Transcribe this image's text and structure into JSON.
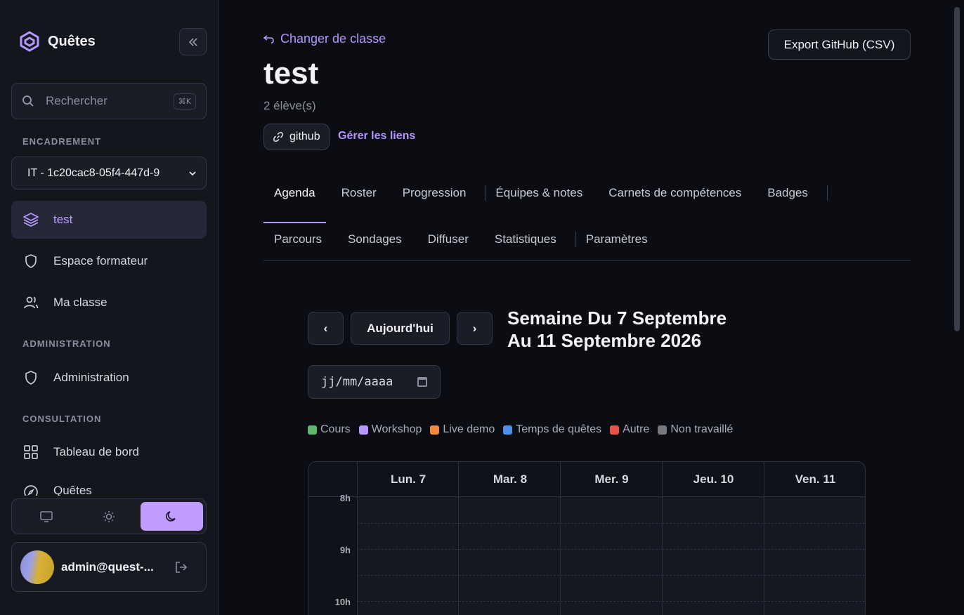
{
  "sidebar": {
    "brand": "Quêtes",
    "search_label": "Rechercher",
    "search_shortcut": "⌘K",
    "section_encadrement": "ENCADREMENT",
    "class_select": "IT - 1c20cac8-05f4-447d-9",
    "nav_encadrement": [
      {
        "label": "test",
        "icon": "layers-icon"
      },
      {
        "label": "Espace formateur",
        "icon": "shield-icon"
      },
      {
        "label": "Ma classe",
        "icon": "users-icon"
      }
    ],
    "section_administration": "ADMINISTRATION",
    "nav_administration": [
      {
        "label": "Administration",
        "icon": "shield-icon"
      }
    ],
    "section_consultation": "CONSULTATION",
    "nav_consultation": [
      {
        "label": "Tableau de bord",
        "icon": "grid-icon"
      },
      {
        "label": "Quêtes",
        "icon": "compass-icon"
      }
    ],
    "theme_options": [
      "system",
      "light",
      "dark"
    ],
    "theme_selected": "dark",
    "user_email": "admin@quest-..."
  },
  "header": {
    "back_link": "Changer de classe",
    "title": "test",
    "student_count": "2 élève(s)",
    "link_chip": "github",
    "manage_links": "Gérer les liens",
    "export_button": "Export GitHub (CSV)"
  },
  "tabs_row1": [
    "Agenda",
    "Roster",
    "Progression",
    "Équipes & notes",
    "Carnets de compétences",
    "Badges"
  ],
  "tabs_row2": [
    "Parcours",
    "Sondages",
    "Diffuser",
    "Statistiques",
    "Paramètres"
  ],
  "active_tab": "Agenda",
  "agenda": {
    "prev": "‹",
    "today": "Aujourd'hui",
    "next": "›",
    "week_line1": "Semaine Du 7 Septembre",
    "week_line2": "Au 11 Septembre 2026",
    "date_placeholder": "jj/mm/aaaa",
    "legend": [
      {
        "label": "Cours",
        "color": "#5fb56a"
      },
      {
        "label": "Workshop",
        "color": "#b597ff"
      },
      {
        "label": "Live demo",
        "color": "#f08a3c"
      },
      {
        "label": "Temps de quêtes",
        "color": "#4f8fe8"
      },
      {
        "label": "Autre",
        "color": "#e5534b"
      },
      {
        "label": "Non travaillé",
        "color": "#77797f"
      }
    ],
    "days": [
      "Lun. 7",
      "Mar. 8",
      "Mer. 9",
      "Jeu. 10",
      "Ven. 11"
    ],
    "hours": [
      "8h",
      "9h",
      "10h"
    ]
  }
}
